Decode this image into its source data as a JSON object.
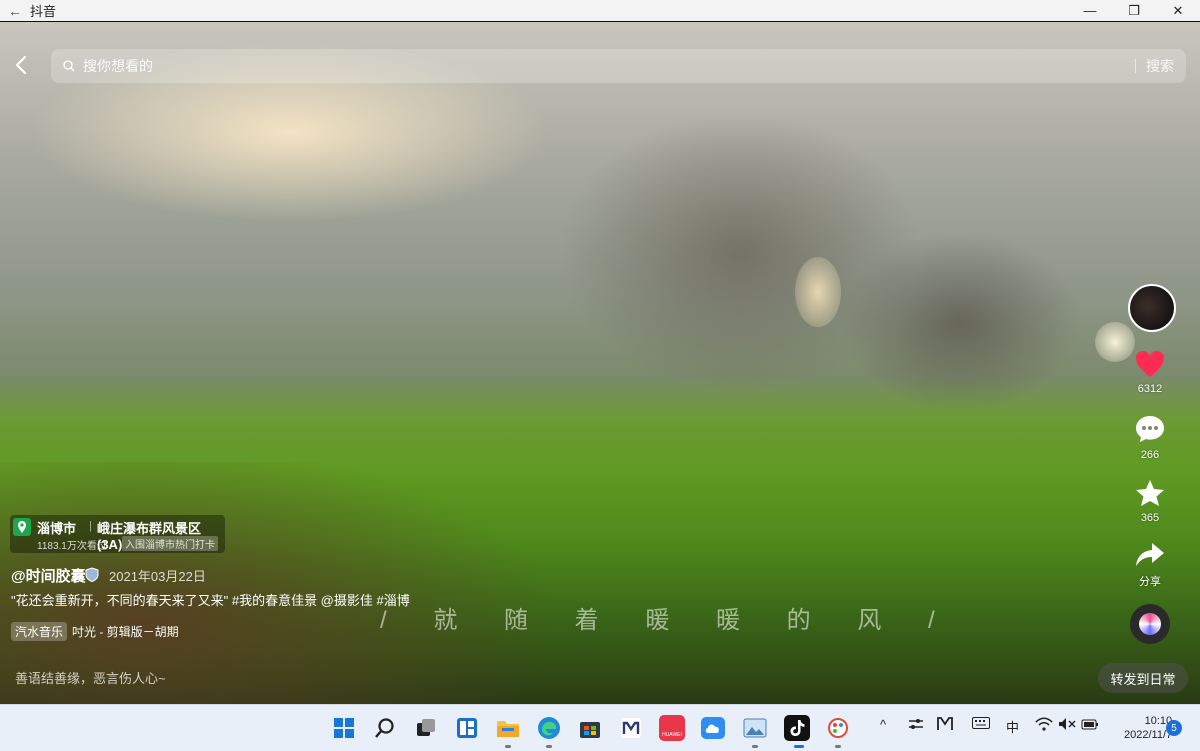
{
  "window": {
    "title": "抖音",
    "back_glyph": "←",
    "minimize_glyph": "—",
    "restore_glyph": "❐",
    "close_glyph": "✕"
  },
  "search": {
    "placeholder": "搜你想看的",
    "button": "搜索"
  },
  "rail": {
    "likes": "6312",
    "comments": "266",
    "favorites": "365",
    "share_label": "分享",
    "colors": {
      "like": "#fe2c55",
      "icon": "#ffffff"
    }
  },
  "video_info": {
    "city": "淄博市",
    "city_sep": "|",
    "scenic_spot": "峨庄瀑布群风景区(3A)",
    "views": "1183.1万次看过",
    "rank": "入围淄博市热门打卡",
    "author": "@时间胶囊",
    "date": "2021年03月22日",
    "caption": "\"花还会重新开，不同的春天来了又来\" #我的春意佳景 @摄影佳 #淄博",
    "music_tag": "汽水音乐",
    "music_name": "吋光 - 剪辑版－胡期",
    "lyric": "/ 就 随 着 暖 暖 的 风 /",
    "motto": "善语结善缘，恶言伤人心~",
    "forward_button": "转发到日常"
  },
  "taskbar": {
    "icons": [
      "windows-start-icon",
      "search-icon",
      "task-view-icon",
      "widgets-icon",
      "file-explorer-icon",
      "edge-icon",
      "store-icon",
      "app-m-icon",
      "huawei-appgallery-icon",
      "cloud-icon",
      "photos-icon",
      "douyin-icon",
      "paint-icon"
    ],
    "huawei_label": "HUAWEI",
    "tray": {
      "chevron": "^",
      "ime": "中",
      "mute": "🔇"
    },
    "clock_time": "10:10",
    "clock_date": "2022/11/7",
    "notifications": "5"
  }
}
